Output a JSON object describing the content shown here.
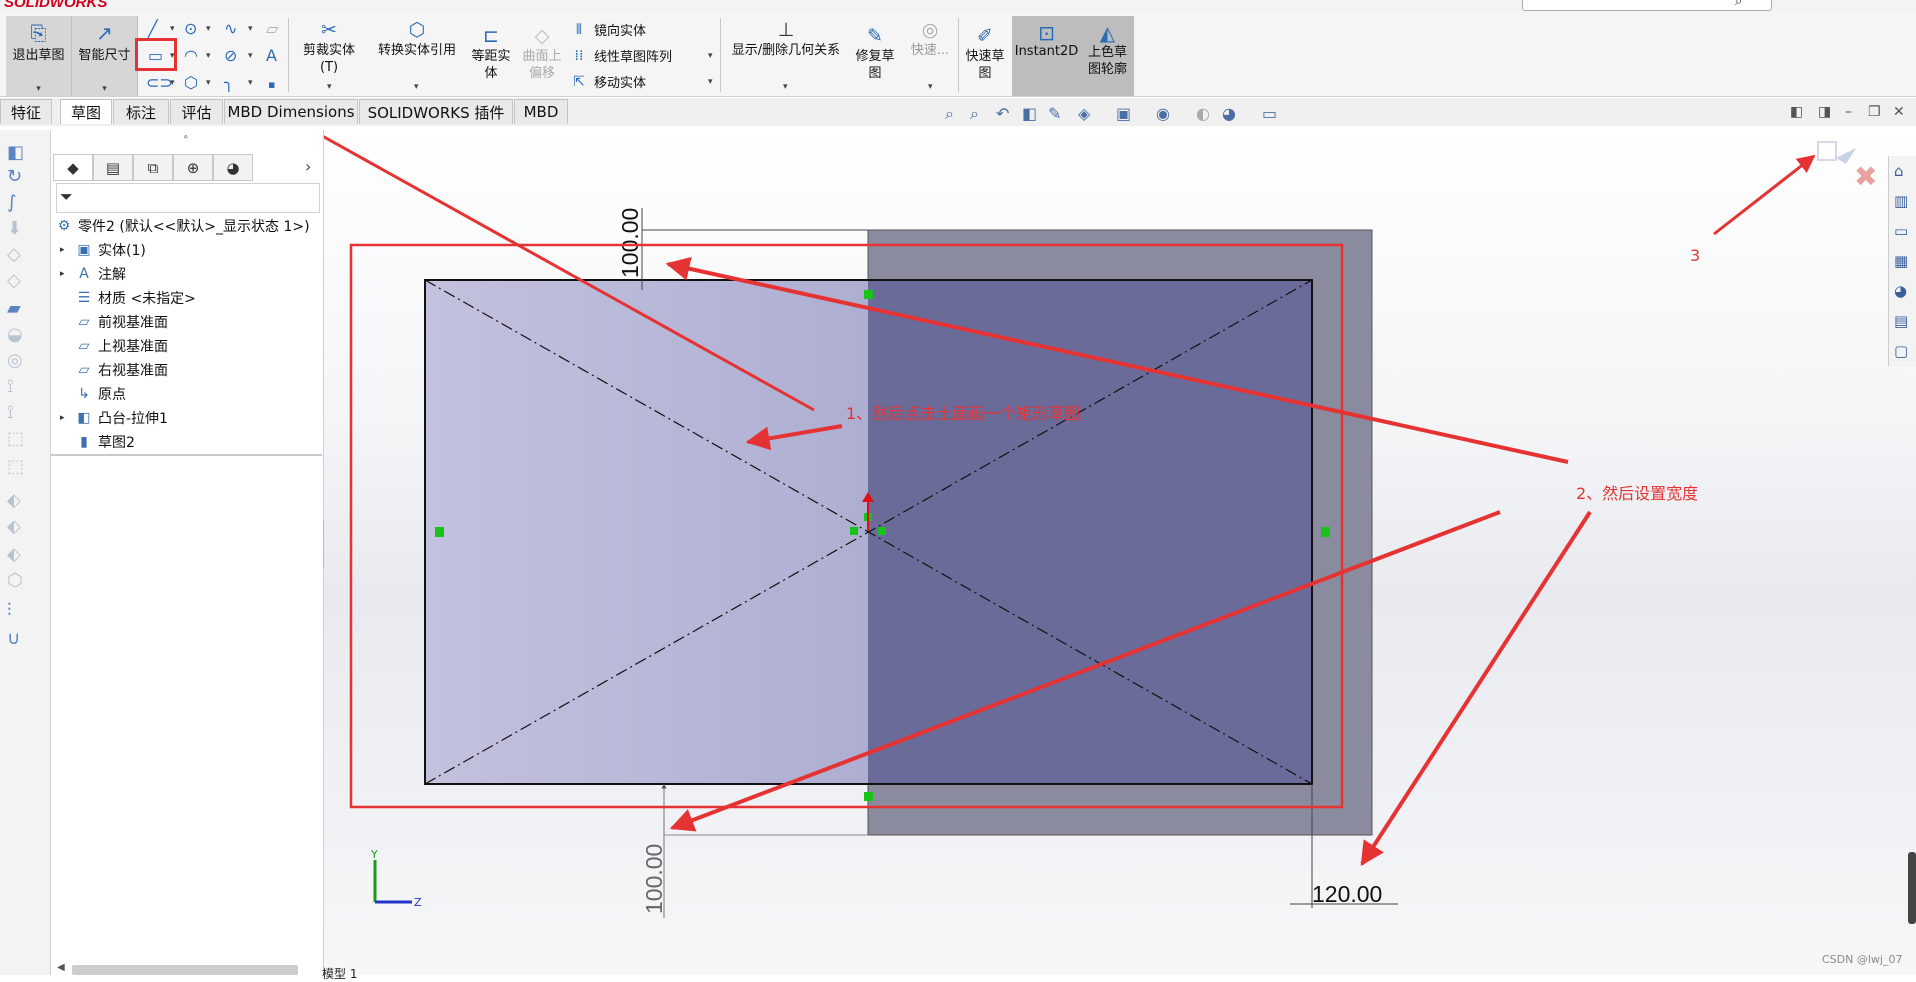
{
  "app": {
    "logo": "SOLIDWORKS"
  },
  "ribbon": {
    "exit_sketch": "退出草图",
    "smart_dimension": "智能尺寸",
    "trim_entities": "剪裁实体(T)",
    "convert_entities": "转换实体引用",
    "offset_entities": "等距实体",
    "offset_surface": "曲面上偏移",
    "mirror_entities": "镜向实体",
    "linear_pattern": "线性草图阵列",
    "move_entities": "移动实体",
    "display_relations": "显示/删除几何关系",
    "repair_sketch": "修复草图",
    "quick_snaps": "快速...",
    "rapid_sketch": "快速草图",
    "instant2d": "Instant2D",
    "shaded_contours": "上色草图轮廓"
  },
  "tabs": [
    {
      "label": "特征",
      "active": false
    },
    {
      "label": "草图",
      "active": true
    },
    {
      "label": "标注",
      "active": false
    },
    {
      "label": "评估",
      "active": false
    },
    {
      "label": "MBD Dimensions",
      "active": false
    },
    {
      "label": "SOLIDWORKS 插件",
      "active": false
    },
    {
      "label": "MBD",
      "active": false
    }
  ],
  "feature_tree": {
    "root": "零件2  (默认<<默认>_显示状态 1>)",
    "items": [
      {
        "label": "实体(1)",
        "icon": "solid-bodies-icon",
        "expandable": true
      },
      {
        "label": "注解",
        "icon": "annotations-icon",
        "expandable": true
      },
      {
        "label": "材质 <未指定>",
        "icon": "material-icon",
        "expandable": false
      },
      {
        "label": "前视基准面",
        "icon": "plane-icon",
        "expandable": false
      },
      {
        "label": "上视基准面",
        "icon": "plane-icon",
        "expandable": false
      },
      {
        "label": "右视基准面",
        "icon": "plane-icon",
        "expandable": false
      },
      {
        "label": "原点",
        "icon": "origin-icon",
        "expandable": false
      },
      {
        "label": "凸台-拉伸1",
        "icon": "boss-extrude-icon",
        "expandable": true
      },
      {
        "label": "草图2",
        "icon": "sketch-icon",
        "expandable": false
      }
    ]
  },
  "dimensions": {
    "top_height": "100.00",
    "bottom_height": "100.00",
    "width": "120.00"
  },
  "triad": {
    "y": "Y",
    "z": "Z"
  },
  "annotations": {
    "step1": "1、然后点击土面画一个矩形草图",
    "step2": "2、然后设置宽度",
    "step3": "3"
  },
  "status": {
    "bottom_tab": "模型 1"
  },
  "watermark": "CSDN @lwj_07",
  "colors": {
    "annotation_red": "#e53333",
    "sketch_fill": "#b9b9da",
    "solid_face": "#6b6b9a",
    "solid_outer": "#8a8a9e"
  }
}
